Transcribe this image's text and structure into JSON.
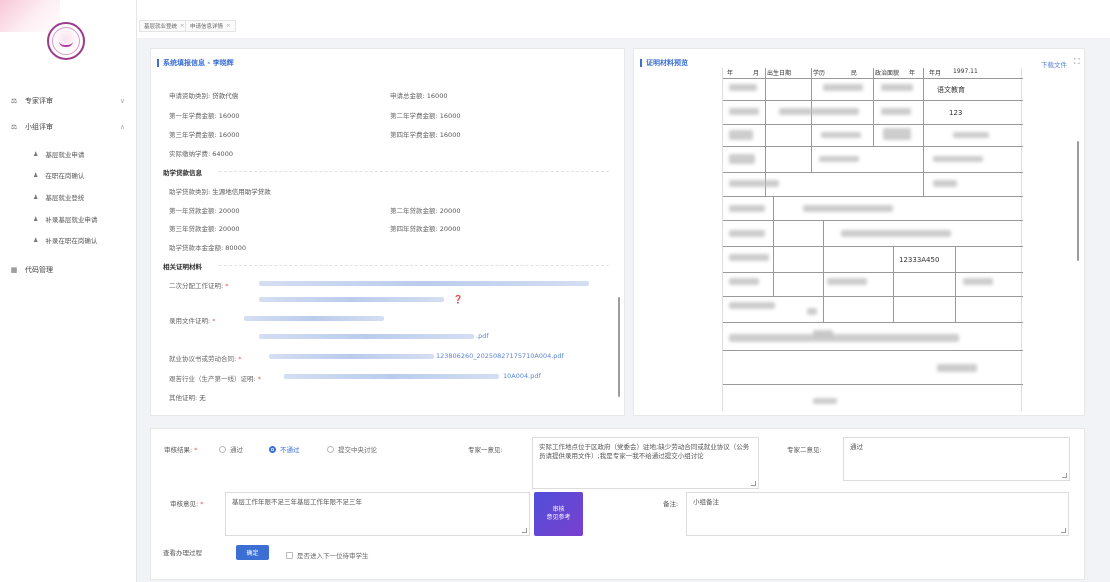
{
  "sidebar": {
    "items": [
      {
        "icon": "review-icon",
        "label": "专家评审",
        "arrow": "∨"
      },
      {
        "icon": "review-icon",
        "label": "小组评审",
        "arrow": "∧"
      }
    ],
    "sub_items": [
      {
        "label": "基层就业申请"
      },
      {
        "label": "在职在岗确认"
      },
      {
        "label": "基层就业登统"
      },
      {
        "label": "补录基层就业申请"
      },
      {
        "label": "补录在职在岗确认"
      }
    ],
    "code_item": {
      "label": "代码管理",
      "icon": "table-icon"
    }
  },
  "tabs": [
    {
      "label": "基层就业登统"
    },
    {
      "label": "申请信息详情"
    }
  ],
  "left_panel": {
    "title": "系统填报信息 - 李晓辉",
    "app_type": {
      "label": "申请资助类别:",
      "value": "贷款代偿"
    },
    "total_amount": {
      "label": "申请总金额:",
      "value": "16000"
    },
    "year1_fee": {
      "label": "第一年学费金额:",
      "value": "16000"
    },
    "year2_fee": {
      "label": "第二年学费金额:",
      "value": "16000"
    },
    "year3_fee": {
      "label": "第三年学费金额:",
      "value": "16000"
    },
    "year4_fee": {
      "label": "第四年学费金额:",
      "value": "16000"
    },
    "actual_fee": {
      "label": "实际缴纳学费:",
      "value": "64000"
    },
    "loan_section": "助学贷款信息",
    "loan_type": {
      "label": "助学贷款类别:",
      "value": "生源地信用助学贷款"
    },
    "loan1": {
      "label": "第一年贷款金额:",
      "value": "20000"
    },
    "loan2": {
      "label": "第二年贷款金额:",
      "value": "20000"
    },
    "loan3": {
      "label": "第三年贷款金额:",
      "value": "20000"
    },
    "loan4": {
      "label": "第四年贷款金额:",
      "value": "20000"
    },
    "loan_total": {
      "label": "助学贷款本金金额:",
      "value": "80000"
    },
    "proof_section": "相关证明材料",
    "proof1": {
      "label": "二次分配工作证明:"
    },
    "proof2": {
      "label": "录用文件证明:",
      "file_tail": ".pdf"
    },
    "proof3": {
      "label": "就业协议书或劳动合同:",
      "file_tail": "123806260_20250827175710A004.pdf"
    },
    "proof4": {
      "label": "艰苦行业（生产第一线）证明:",
      "file_tail": "10A004.pdf"
    },
    "other": {
      "label": "其他证明:",
      "value": "无"
    }
  },
  "right_panel": {
    "title": "证明材料预览",
    "download": "下载文件",
    "doc": {
      "header_cells": [
        "年",
        "月",
        "出生日期",
        "学历",
        "民",
        "政治面貌",
        "年",
        "年月",
        "1997.11"
      ],
      "subject": "语文教育",
      "code_small": "123",
      "long_code": "12333A450"
    }
  },
  "form": {
    "result_label": "审核结果:",
    "options": [
      "通过",
      "不通过",
      "提交中央讨论"
    ],
    "selected_option": "不通过",
    "expert1_label": "专家一意见:",
    "expert1_text": "实际工作地点位于区政府（党委会）驻地;缺少劳动合同或就业协议（公务员请提供录用文件）;我是专家一我不给通过提交小组讨论",
    "expert2_label": "专家二意见:",
    "expert2_text": "通过",
    "opinion_label": "审核意见:",
    "opinion_text": "基层工作年限不足三年基层工作年限不足三年",
    "ai_button_line1": "审核",
    "ai_button_line2": "意见参考",
    "remark_label": "备注:",
    "remark_text": "小组备注",
    "history_link": "查看办理过程",
    "confirm_label": "确定",
    "next_checkbox": "是否进入下一位待审学生"
  },
  "colors": {
    "accent": "#3b6fd4",
    "ai_button": "#5b45d6",
    "required": "#e25555"
  }
}
